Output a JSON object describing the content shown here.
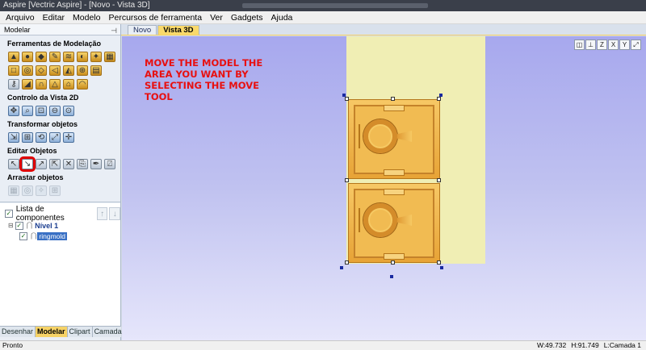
{
  "window": {
    "title": "Aspire [Vectric Aspire] - [Novo - Vista 3D]"
  },
  "menu": [
    "Arquivo",
    "Editar",
    "Modelo",
    "Percursos de ferramenta",
    "Ver",
    "Gadgets",
    "Ajuda"
  ],
  "sidebar": {
    "header": "Modelar",
    "pin_icon": "pin-icon",
    "sections": {
      "modeling_tools": "Ferramentas de Modelação",
      "view_2d": "Controlo da Vista 2D",
      "transform": "Transformar objetos",
      "edit": "Editar Objetos",
      "drag": "Arrastar objetos"
    },
    "component_list": {
      "title": "Lista de componentes",
      "tree": [
        {
          "label": "Nível 1",
          "checked": true
        },
        {
          "label": "ringmold",
          "checked": true,
          "selected": true
        }
      ]
    },
    "bottom_tabs": [
      {
        "label": "Desenhar",
        "active": false
      },
      {
        "label": "Modelar",
        "active": true
      },
      {
        "label": "Clipart",
        "active": false
      },
      {
        "label": "Camadas",
        "active": false
      }
    ]
  },
  "doc_tabs": [
    {
      "label": "Novo",
      "active": false
    },
    {
      "label": "Vista 3D",
      "active": true
    }
  ],
  "viewport": {
    "instruction": "MOVE THE MODEL THE\nAREA YOU WANT BY\nSELECTING THE MOVE\nTOOL",
    "instruction_color": "#e81010",
    "model_name": "ringmold"
  },
  "status": {
    "left": "Pronto",
    "width": "W:49.732",
    "height": "H:91.749",
    "layer": "L:Camada 1"
  },
  "colors": {
    "accent": "#f6d266",
    "selection_highlight": "#e00000",
    "material": "#f0eeb4",
    "model": "#f1bb52"
  }
}
